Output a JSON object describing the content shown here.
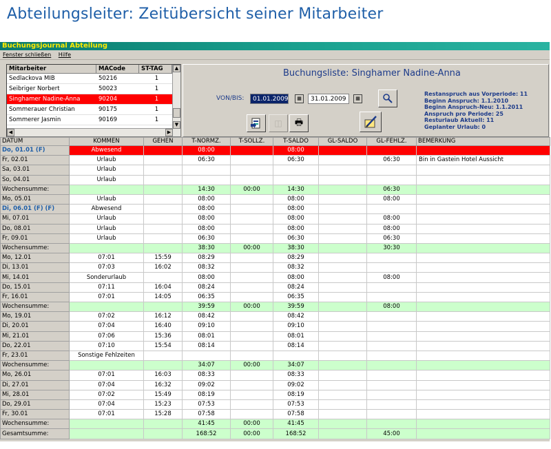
{
  "slide_title": "Abteilungsleiter: Zeitübersicht seiner Mitarbeiter",
  "window": {
    "title": "Buchungsjournal Abteilung",
    "menu": [
      "Fenster schließen",
      "Hilfe"
    ]
  },
  "employees": {
    "headers": [
      "Mitarbeiter",
      "MACode",
      "ST-TAG"
    ],
    "rows": [
      {
        "name": "Sedlackova MIB",
        "code": "50216",
        "st": "1",
        "selected": false
      },
      {
        "name": "Seibriger Norbert",
        "code": "50023",
        "st": "1",
        "selected": false
      },
      {
        "name": "Singhamer Nadine-Anna",
        "code": "90204",
        "st": "1",
        "selected": true
      },
      {
        "name": "Sommerauer Christian",
        "code": "90175",
        "st": "1",
        "selected": false
      },
      {
        "name": "Sommerer Jasmin",
        "code": "90169",
        "st": "1",
        "selected": false
      }
    ]
  },
  "booking": {
    "title": "Buchungsliste: Singhamer Nadine-Anna",
    "von_bis_label": "VON/BIS:",
    "from": "01.01.2009",
    "to": "31.01.2009",
    "info": [
      "Restanspruch aus Vorperiode: 11",
      "Beginn Anspruch: 1.1.2010",
      "Beginn Anspruch-Neu: 1.1.2011",
      "Anspruch pro Periode: 25",
      "Resturlaub Aktuell: 11",
      "Geplanter Urlaub: 0"
    ],
    "icons": {
      "search": "search-icon",
      "export": "export-icon",
      "disabled": "disabled-icon",
      "print": "print-icon",
      "edit": "edit-icon"
    }
  },
  "table": {
    "headers": [
      "DATUM",
      "KOMMEN",
      "GEHEN",
      "T-NORMZ.",
      "T-SOLLZ.",
      "T-SALDO",
      "GL-SALDO",
      "GL-FEHLZ.",
      "BEMERKUNG"
    ],
    "rows": [
      {
        "type": "red",
        "cells": [
          "Do, 01.01 (F)",
          "Abwesend",
          "",
          "08:00",
          "",
          "08:00",
          "",
          "",
          ""
        ]
      },
      {
        "type": "day",
        "cells": [
          "Fr, 02.01",
          "Urlaub",
          "",
          "06:30",
          "",
          "06:30",
          "",
          "06:30",
          "Bin in Gastein Hotel Aussicht"
        ]
      },
      {
        "type": "day",
        "cells": [
          "Sa, 03.01",
          "Urlaub",
          "",
          "",
          "",
          "",
          "",
          "",
          ""
        ]
      },
      {
        "type": "day",
        "cells": [
          "So, 04.01",
          "Urlaub",
          "",
          "",
          "",
          "",
          "",
          "",
          ""
        ]
      },
      {
        "type": "sum",
        "cells": [
          "Wochensumme:",
          "",
          "",
          "14:30",
          "00:00",
          "14:30",
          "",
          "06:30",
          ""
        ]
      },
      {
        "type": "day",
        "cells": [
          "Mo, 05.01",
          "Urlaub",
          "",
          "08:00",
          "",
          "08:00",
          "",
          "08:00",
          ""
        ]
      },
      {
        "type": "hol",
        "cells": [
          "Di, 06.01 (F) (F)",
          "Abwesend",
          "",
          "08:00",
          "",
          "08:00",
          "",
          "",
          ""
        ]
      },
      {
        "type": "day",
        "cells": [
          "Mi, 07.01",
          "Urlaub",
          "",
          "08:00",
          "",
          "08:00",
          "",
          "08:00",
          ""
        ]
      },
      {
        "type": "day",
        "cells": [
          "Do, 08.01",
          "Urlaub",
          "",
          "08:00",
          "",
          "08:00",
          "",
          "08:00",
          ""
        ]
      },
      {
        "type": "day",
        "cells": [
          "Fr, 09.01",
          "Urlaub",
          "",
          "06:30",
          "",
          "06:30",
          "",
          "06:30",
          ""
        ]
      },
      {
        "type": "sum",
        "cells": [
          "Wochensumme:",
          "",
          "",
          "38:30",
          "00:00",
          "38:30",
          "",
          "30:30",
          ""
        ]
      },
      {
        "type": "day",
        "cells": [
          "Mo, 12.01",
          "07:01",
          "15:59",
          "08:29",
          "",
          "08:29",
          "",
          "",
          ""
        ]
      },
      {
        "type": "day",
        "cells": [
          "Di, 13.01",
          "07:03",
          "16:02",
          "08:32",
          "",
          "08:32",
          "",
          "",
          ""
        ]
      },
      {
        "type": "day",
        "cells": [
          "Mi, 14.01",
          "Sonderurlaub",
          "",
          "08:00",
          "",
          "08:00",
          "",
          "08:00",
          ""
        ]
      },
      {
        "type": "day",
        "cells": [
          "Do, 15.01",
          "07:11",
          "16:04",
          "08:24",
          "",
          "08:24",
          "",
          "",
          ""
        ]
      },
      {
        "type": "day",
        "cells": [
          "Fr, 16.01",
          "07:01",
          "14:05",
          "06:35",
          "",
          "06:35",
          "",
          "",
          ""
        ]
      },
      {
        "type": "sum",
        "cells": [
          "Wochensumme:",
          "",
          "",
          "39:59",
          "00:00",
          "39:59",
          "",
          "08:00",
          ""
        ]
      },
      {
        "type": "day",
        "cells": [
          "Mo, 19.01",
          "07:02",
          "16:12",
          "08:42",
          "",
          "08:42",
          "",
          "",
          ""
        ]
      },
      {
        "type": "day",
        "cells": [
          "Di, 20.01",
          "07:04",
          "16:40",
          "09:10",
          "",
          "09:10",
          "",
          "",
          ""
        ]
      },
      {
        "type": "day",
        "cells": [
          "Mi, 21.01",
          "07:06",
          "15:36",
          "08:01",
          "",
          "08:01",
          "",
          "",
          ""
        ]
      },
      {
        "type": "day",
        "cells": [
          "Do, 22.01",
          "07:10",
          "15:54",
          "08:14",
          "",
          "08:14",
          "",
          "",
          ""
        ]
      },
      {
        "type": "day",
        "cells": [
          "Fr, 23.01",
          "Sonstige Fehlzeiten",
          "",
          "",
          "",
          "",
          "",
          "",
          ""
        ]
      },
      {
        "type": "sum",
        "cells": [
          "Wochensumme:",
          "",
          "",
          "34:07",
          "00:00",
          "34:07",
          "",
          "",
          ""
        ]
      },
      {
        "type": "day",
        "cells": [
          "Mo, 26.01",
          "07:01",
          "16:03",
          "08:33",
          "",
          "08:33",
          "",
          "",
          ""
        ]
      },
      {
        "type": "day",
        "cells": [
          "Di, 27.01",
          "07:04",
          "16:32",
          "09:02",
          "",
          "09:02",
          "",
          "",
          ""
        ]
      },
      {
        "type": "day",
        "cells": [
          "Mi, 28.01",
          "07:02",
          "15:49",
          "08:19",
          "",
          "08:19",
          "",
          "",
          ""
        ]
      },
      {
        "type": "day",
        "cells": [
          "Do, 29.01",
          "07:04",
          "15:23",
          "07:53",
          "",
          "07:53",
          "",
          "",
          ""
        ]
      },
      {
        "type": "day",
        "cells": [
          "Fr, 30.01",
          "07:01",
          "15:28",
          "07:58",
          "",
          "07:58",
          "",
          "",
          ""
        ]
      },
      {
        "type": "sum",
        "cells": [
          "Wochensumme:",
          "",
          "",
          "41:45",
          "00:00",
          "41:45",
          "",
          "",
          ""
        ]
      },
      {
        "type": "sum",
        "cells": [
          "Gesamtsumme:",
          "",
          "",
          "168:52",
          "00:00",
          "168:52",
          "",
          "45:00",
          ""
        ]
      }
    ]
  }
}
